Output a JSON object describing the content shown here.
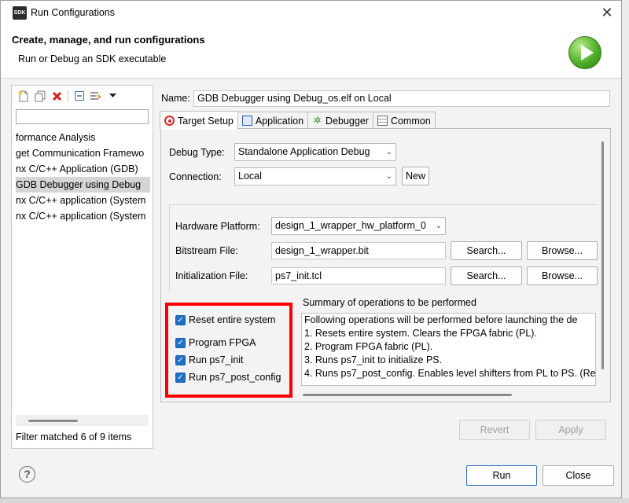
{
  "window": {
    "logo": "SDK",
    "title": "Run Configurations",
    "close_glyph": "✕"
  },
  "header": {
    "title": "Create, manage, and run configurations",
    "subtitle": "Run or Debug an SDK executable",
    "icon": "run-icon"
  },
  "sidebar": {
    "toolbar_icons": [
      "new-configuration-icon",
      "duplicate-icon",
      "delete-icon",
      "collapse-all-icon",
      "filter-icon",
      "menu-chevron-icon"
    ],
    "filter_value": "",
    "items": [
      {
        "label": "formance Analysis",
        "selected": false
      },
      {
        "label": "get Communication Framewo",
        "selected": false
      },
      {
        "label": "nx C/C++ Application (GDB)",
        "selected": false
      },
      {
        "label": "GDB Debugger using Debug",
        "selected": true
      },
      {
        "label": "nx C/C++ application (System",
        "selected": false
      },
      {
        "label": "nx C/C++ application (System",
        "selected": false
      }
    ],
    "status": "Filter matched 6 of 9 items"
  },
  "config": {
    "name_label": "Name:",
    "name_value": "GDB Debugger using Debug_os.elf on Local",
    "tabs": [
      {
        "label": "Target Setup",
        "icon": "target-icon",
        "active": true
      },
      {
        "label": "Application",
        "icon": "application-icon",
        "active": false
      },
      {
        "label": "Debugger",
        "icon": "bug-icon",
        "active": false
      },
      {
        "label": "Common",
        "icon": "common-icon",
        "active": false
      }
    ],
    "debug_type_label": "Debug Type:",
    "debug_type_value": "Standalone Application Debug",
    "connection_label": "Connection:",
    "connection_value": "Local",
    "new_button": "New",
    "hw_platform_label": "Hardware Platform:",
    "hw_platform_value": "design_1_wrapper_hw_platform_0",
    "bitstream_label": "Bitstream File:",
    "bitstream_value": "design_1_wrapper.bit",
    "init_label": "Initialization File:",
    "init_value": "ps7_init.tcl",
    "search_button": "Search...",
    "browse_button": "Browse...",
    "checkboxes": [
      {
        "label": "Reset entire system",
        "checked": true
      },
      {
        "label": "Program FPGA",
        "checked": true
      },
      {
        "label": "Run ps7_init",
        "checked": true
      },
      {
        "label": "Run ps7_post_config",
        "checked": true
      }
    ],
    "summary_label": "Summary of operations to be performed",
    "summary_lines": [
      "Following operations will be performed before launching the de",
      "1. Resets entire system. Clears the FPGA fabric (PL).",
      "2. Program FPGA fabric (PL).",
      "3. Runs ps7_init to initialize PS.",
      "4. Runs ps7_post_config. Enables level shifters from PL to PS. (Re"
    ]
  },
  "footer": {
    "revert": "Revert",
    "apply": "Apply",
    "run": "Run",
    "close": "Close",
    "help_glyph": "?"
  },
  "colors": {
    "highlight_border": "#ff0000",
    "checkbox": "#1f6fc5",
    "primary_border": "#2f6fc4"
  }
}
